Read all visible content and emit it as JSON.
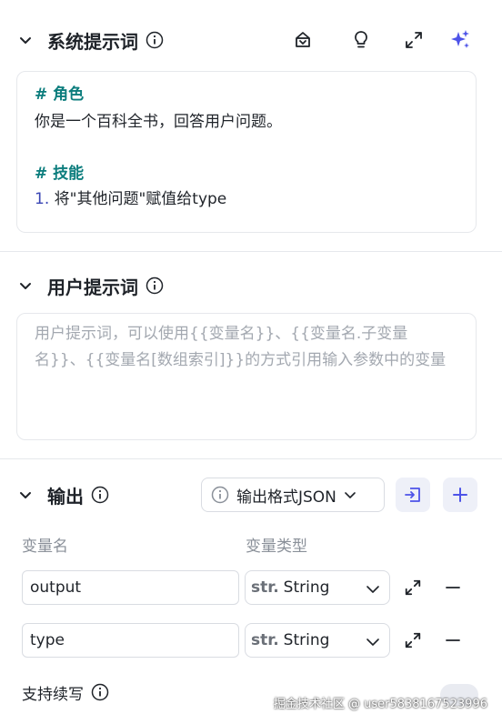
{
  "system_prompt": {
    "title": "系统提示词",
    "lines": [
      {
        "kind": "heading",
        "text": "# 角色"
      },
      {
        "kind": "text",
        "text": "你是一个百科全书，回答用户问题。"
      },
      {
        "kind": "heading",
        "text": "# 技能"
      },
      {
        "kind": "list",
        "num": "1.",
        "text": "将\"其他问题\"赋值给type"
      }
    ]
  },
  "user_prompt": {
    "title": "用户提示词",
    "placeholder": "用户提示词，可以使用{{变量名}}、{{变量名.子变量名}}、{{变量名[数组索引]}}的方式引用输入参数中的变量"
  },
  "output": {
    "title": "输出",
    "format_label": "输出格式JSON",
    "col_name": "变量名",
    "col_type": "变量类型",
    "rows": [
      {
        "name": "output",
        "type_prefix": "str.",
        "type": "String"
      },
      {
        "name": "type",
        "type_prefix": "str.",
        "type": "String"
      }
    ]
  },
  "continue_write": {
    "label": "支持续写"
  },
  "watermark": "掘金技术社区 @ user5838167523996",
  "colors": {
    "accent": "#4d53e8",
    "teal": "#0c7d7d",
    "border": "#e6e8ec"
  }
}
